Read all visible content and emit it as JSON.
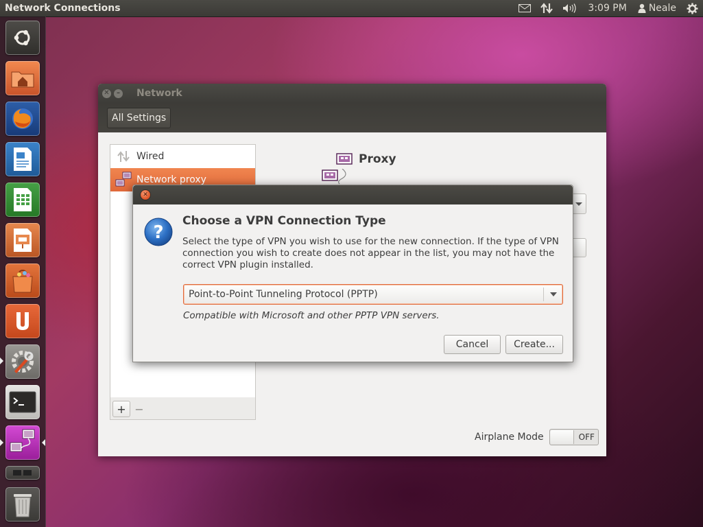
{
  "top_panel": {
    "app_title": "Network Connections",
    "clock": "3:09 PM",
    "user": "Neale",
    "indicators": [
      "mail-icon",
      "network-updown-icon",
      "volume-icon"
    ],
    "settings_icon": "gear-icon"
  },
  "launcher": {
    "items": [
      {
        "name": "ubuntu-dash",
        "icon": "ubuntu-logo-icon"
      },
      {
        "name": "home-folder",
        "icon": "home-folder-icon"
      },
      {
        "name": "firefox",
        "icon": "firefox-icon"
      },
      {
        "name": "libreoffice-writer",
        "icon": "writer-icon"
      },
      {
        "name": "libreoffice-calc",
        "icon": "calc-icon"
      },
      {
        "name": "libreoffice-impress",
        "icon": "impress-icon"
      },
      {
        "name": "software-center",
        "icon": "shopping-bag-icon"
      },
      {
        "name": "ubuntu-one",
        "icon": "ubuntu-one-icon"
      },
      {
        "name": "system-settings",
        "icon": "settings-wrench-icon"
      },
      {
        "name": "terminal",
        "icon": "terminal-icon"
      },
      {
        "name": "network-connections",
        "icon": "network-icon"
      },
      {
        "name": "workspace-switcher",
        "icon": "workspace-icon"
      },
      {
        "name": "trash",
        "icon": "trash-icon"
      }
    ]
  },
  "network_window": {
    "title": "Network",
    "all_settings": "All Settings",
    "devices": [
      {
        "label": "Wired",
        "icon": "wired-arrows-icon",
        "selected": false
      },
      {
        "label": "Network proxy",
        "icon": "network-proxy-icon",
        "selected": true
      }
    ],
    "add_label": "+",
    "remove_label": "−",
    "proxy_title": "Proxy",
    "airplane_label": "Airplane Mode",
    "airplane_state": "OFF"
  },
  "vpn_dialog": {
    "heading": "Choose a VPN Connection Type",
    "body": "Select the type of VPN you wish to use for the new connection.  If the type of VPN connection you wish to create does not appear in the list, you may not have the correct VPN plugin installed.",
    "selected_type": "Point-to-Point Tunneling Protocol (PPTP)",
    "type_description": "Compatible with Microsoft and other PPTP VPN servers.",
    "cancel_label": "Cancel",
    "create_label": "Create..."
  },
  "colors": {
    "accent_orange": "#e0693a",
    "panel_dark": "#3c3b37",
    "window_bg": "#f2f1f0"
  }
}
